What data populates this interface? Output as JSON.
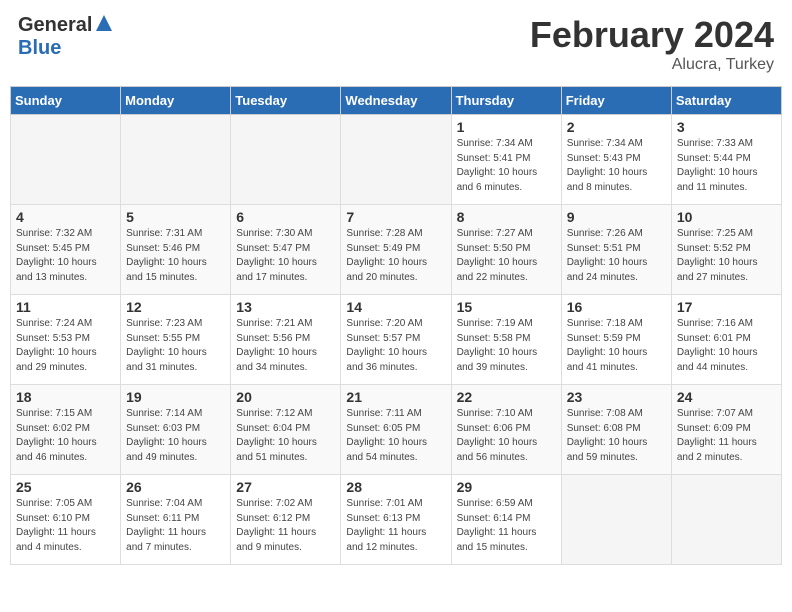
{
  "header": {
    "logo_general": "General",
    "logo_blue": "Blue",
    "month_title": "February 2024",
    "location": "Alucra, Turkey"
  },
  "days_of_week": [
    "Sunday",
    "Monday",
    "Tuesday",
    "Wednesday",
    "Thursday",
    "Friday",
    "Saturday"
  ],
  "weeks": [
    [
      {
        "num": "",
        "info": ""
      },
      {
        "num": "",
        "info": ""
      },
      {
        "num": "",
        "info": ""
      },
      {
        "num": "",
        "info": ""
      },
      {
        "num": "1",
        "info": "Sunrise: 7:34 AM\nSunset: 5:41 PM\nDaylight: 10 hours\nand 6 minutes."
      },
      {
        "num": "2",
        "info": "Sunrise: 7:34 AM\nSunset: 5:43 PM\nDaylight: 10 hours\nand 8 minutes."
      },
      {
        "num": "3",
        "info": "Sunrise: 7:33 AM\nSunset: 5:44 PM\nDaylight: 10 hours\nand 11 minutes."
      }
    ],
    [
      {
        "num": "4",
        "info": "Sunrise: 7:32 AM\nSunset: 5:45 PM\nDaylight: 10 hours\nand 13 minutes."
      },
      {
        "num": "5",
        "info": "Sunrise: 7:31 AM\nSunset: 5:46 PM\nDaylight: 10 hours\nand 15 minutes."
      },
      {
        "num": "6",
        "info": "Sunrise: 7:30 AM\nSunset: 5:47 PM\nDaylight: 10 hours\nand 17 minutes."
      },
      {
        "num": "7",
        "info": "Sunrise: 7:28 AM\nSunset: 5:49 PM\nDaylight: 10 hours\nand 20 minutes."
      },
      {
        "num": "8",
        "info": "Sunrise: 7:27 AM\nSunset: 5:50 PM\nDaylight: 10 hours\nand 22 minutes."
      },
      {
        "num": "9",
        "info": "Sunrise: 7:26 AM\nSunset: 5:51 PM\nDaylight: 10 hours\nand 24 minutes."
      },
      {
        "num": "10",
        "info": "Sunrise: 7:25 AM\nSunset: 5:52 PM\nDaylight: 10 hours\nand 27 minutes."
      }
    ],
    [
      {
        "num": "11",
        "info": "Sunrise: 7:24 AM\nSunset: 5:53 PM\nDaylight: 10 hours\nand 29 minutes."
      },
      {
        "num": "12",
        "info": "Sunrise: 7:23 AM\nSunset: 5:55 PM\nDaylight: 10 hours\nand 31 minutes."
      },
      {
        "num": "13",
        "info": "Sunrise: 7:21 AM\nSunset: 5:56 PM\nDaylight: 10 hours\nand 34 minutes."
      },
      {
        "num": "14",
        "info": "Sunrise: 7:20 AM\nSunset: 5:57 PM\nDaylight: 10 hours\nand 36 minutes."
      },
      {
        "num": "15",
        "info": "Sunrise: 7:19 AM\nSunset: 5:58 PM\nDaylight: 10 hours\nand 39 minutes."
      },
      {
        "num": "16",
        "info": "Sunrise: 7:18 AM\nSunset: 5:59 PM\nDaylight: 10 hours\nand 41 minutes."
      },
      {
        "num": "17",
        "info": "Sunrise: 7:16 AM\nSunset: 6:01 PM\nDaylight: 10 hours\nand 44 minutes."
      }
    ],
    [
      {
        "num": "18",
        "info": "Sunrise: 7:15 AM\nSunset: 6:02 PM\nDaylight: 10 hours\nand 46 minutes."
      },
      {
        "num": "19",
        "info": "Sunrise: 7:14 AM\nSunset: 6:03 PM\nDaylight: 10 hours\nand 49 minutes."
      },
      {
        "num": "20",
        "info": "Sunrise: 7:12 AM\nSunset: 6:04 PM\nDaylight: 10 hours\nand 51 minutes."
      },
      {
        "num": "21",
        "info": "Sunrise: 7:11 AM\nSunset: 6:05 PM\nDaylight: 10 hours\nand 54 minutes."
      },
      {
        "num": "22",
        "info": "Sunrise: 7:10 AM\nSunset: 6:06 PM\nDaylight: 10 hours\nand 56 minutes."
      },
      {
        "num": "23",
        "info": "Sunrise: 7:08 AM\nSunset: 6:08 PM\nDaylight: 10 hours\nand 59 minutes."
      },
      {
        "num": "24",
        "info": "Sunrise: 7:07 AM\nSunset: 6:09 PM\nDaylight: 11 hours\nand 2 minutes."
      }
    ],
    [
      {
        "num": "25",
        "info": "Sunrise: 7:05 AM\nSunset: 6:10 PM\nDaylight: 11 hours\nand 4 minutes."
      },
      {
        "num": "26",
        "info": "Sunrise: 7:04 AM\nSunset: 6:11 PM\nDaylight: 11 hours\nand 7 minutes."
      },
      {
        "num": "27",
        "info": "Sunrise: 7:02 AM\nSunset: 6:12 PM\nDaylight: 11 hours\nand 9 minutes."
      },
      {
        "num": "28",
        "info": "Sunrise: 7:01 AM\nSunset: 6:13 PM\nDaylight: 11 hours\nand 12 minutes."
      },
      {
        "num": "29",
        "info": "Sunrise: 6:59 AM\nSunset: 6:14 PM\nDaylight: 11 hours\nand 15 minutes."
      },
      {
        "num": "",
        "info": ""
      },
      {
        "num": "",
        "info": ""
      }
    ]
  ]
}
